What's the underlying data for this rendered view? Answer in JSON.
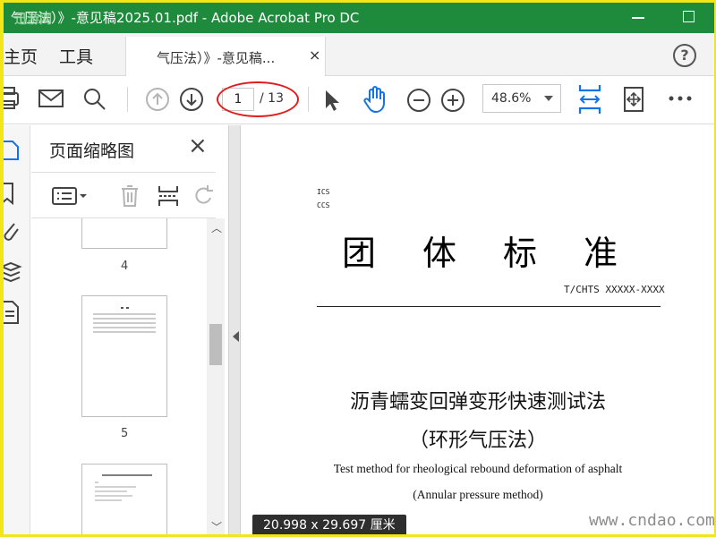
{
  "window": {
    "title": "气压法）》-意见稿2025.01.pdf - Adobe Acrobat Pro DC",
    "watermark": "迅游网"
  },
  "nav": {
    "home": "主页",
    "tools": "工具"
  },
  "tab": {
    "label": "气压法）》-意见稿...",
    "close": "×"
  },
  "help": "?",
  "toolbar": {
    "current_page": "1",
    "total_pages": "/ 13",
    "zoom": "48.6%"
  },
  "pane": {
    "title": "页面缩略图",
    "close": "×",
    "thumbnails": [
      {
        "num": "4"
      },
      {
        "num": "5"
      }
    ]
  },
  "document": {
    "ics": "ICS",
    "ccs": "CCS",
    "org_title": "团体标准",
    "code": "T/CHTS XXXXX-XXXX",
    "title_cn": "沥青蠕变回弹变形快速测试法",
    "subtitle_cn": "（环形气压法）",
    "title_en": "Test method for rheological rebound deformation of asphalt",
    "subtitle_en": "(Annular pressure method)"
  },
  "status": {
    "page_size": "20.998 x 29.697 厘米"
  },
  "site_watermark": "www.cndao.com",
  "colors": {
    "titlebar": "#1e8a3b",
    "accent": "#1473e6",
    "annotation": "#e21c1c",
    "border": "#f2e619"
  }
}
